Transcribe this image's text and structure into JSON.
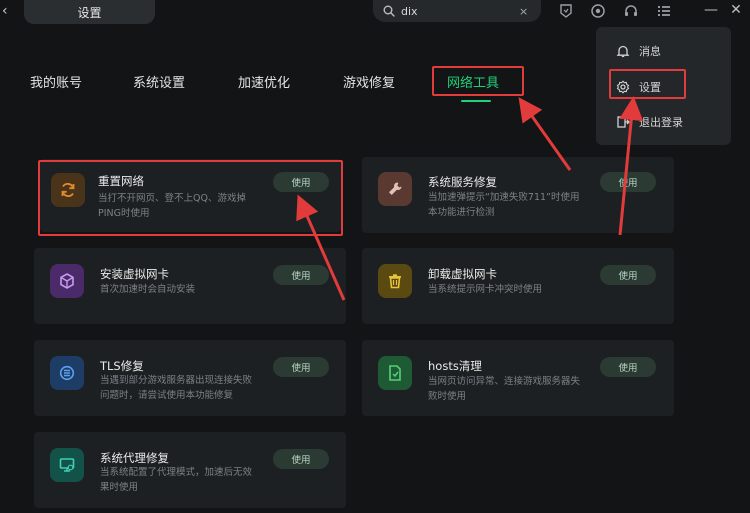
{
  "window": {
    "title": "设置",
    "back_glyph": "‹",
    "minimize_glyph": "—",
    "close_glyph": "✕"
  },
  "search": {
    "value": "dix",
    "clear_glyph": "×"
  },
  "tabs": [
    {
      "label": "我的账号"
    },
    {
      "label": "系统设置"
    },
    {
      "label": "加速优化"
    },
    {
      "label": "游戏修复"
    },
    {
      "label": "网络工具",
      "active": true
    }
  ],
  "menu": {
    "items": [
      {
        "label": "消息",
        "icon": "bell-icon"
      },
      {
        "label": "设置",
        "icon": "gear-icon"
      },
      {
        "label": "退出登录",
        "icon": "door-exit-icon"
      }
    ]
  },
  "cards": [
    {
      "title": "重置网络",
      "desc": "当打不开网页、登不上QQ、游戏掉PING时使用",
      "button": "使用",
      "icon": "refresh-network-icon",
      "icon_color": "#e08a2a",
      "icon_bg": "#4a3419"
    },
    {
      "title": "系统服务修复",
      "desc": "当加速弹提示“加速失败711”时使用本功能进行检测",
      "button": "使用",
      "icon": "wrench-icon",
      "icon_color": "#e2c2b6",
      "icon_bg": "#5a3a30"
    },
    {
      "title": "安装虚拟网卡",
      "desc": "首次加速时会自动安装",
      "button": "使用",
      "icon": "cube-icon",
      "icon_color": "#c79af0",
      "icon_bg": "#4a2a68"
    },
    {
      "title": "卸载虚拟网卡",
      "desc": "当系统提示网卡冲突时使用",
      "button": "使用",
      "icon": "trash-icon",
      "icon_color": "#e8c43a",
      "icon_bg": "#5a4a12"
    },
    {
      "title": "TLS修复",
      "desc": "当遇到部分游戏服务器出现连接失败问题时，请尝试使用本功能修复",
      "button": "使用",
      "icon": "tls-icon",
      "icon_color": "#5aa2f0",
      "icon_bg": "#1d3d66"
    },
    {
      "title": "hosts清理",
      "desc": "当网页访问异常、连接游戏服务器失败时使用",
      "button": "使用",
      "icon": "file-clean-icon",
      "icon_color": "#58d078",
      "icon_bg": "#1e5a34"
    },
    {
      "title": "系统代理修复",
      "desc": "当系统配置了代理模式，加速后无效果时使用",
      "button": "使用",
      "icon": "monitor-proxy-icon",
      "icon_color": "#3ed0b8",
      "icon_bg": "#135248"
    }
  ],
  "colors": {
    "accent": "#23d07a",
    "annotation": "#e23b3b",
    "background": "#121416",
    "card": "#1d2023"
  }
}
